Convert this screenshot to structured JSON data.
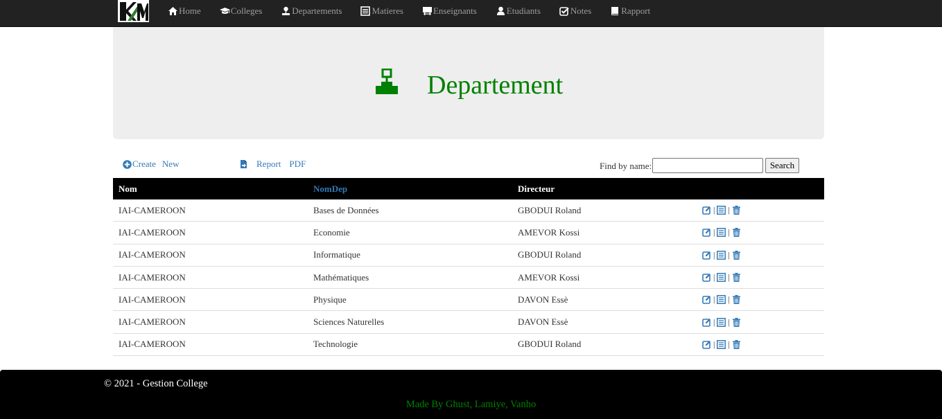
{
  "nav": {
    "items": [
      {
        "label": "Home",
        "icon": "home-icon"
      },
      {
        "label": "Colleges",
        "icon": "graduation-cap-icon"
      },
      {
        "label": "Departements",
        "icon": "map-marker-icon"
      },
      {
        "label": "Matieres",
        "icon": "list-alt-icon"
      },
      {
        "label": "Enseignants",
        "icon": "blackboard-icon"
      },
      {
        "label": "Etudiants",
        "icon": "user-icon"
      },
      {
        "label": "Notes",
        "icon": "check-icon"
      },
      {
        "label": "Rapport",
        "icon": "book-icon"
      }
    ]
  },
  "header": {
    "title": "Departement",
    "icon": "sitemap-icon"
  },
  "actions": {
    "create_label": "Create",
    "new_label": "New",
    "report_label": "Report",
    "pdf_label": "PDF",
    "search_label": "Find by name:",
    "search_value": "",
    "search_button": "Search"
  },
  "table": {
    "columns": [
      "Nom",
      "NomDep",
      "Directeur"
    ],
    "rows": [
      {
        "nom": "IAI-CAMEROON",
        "nomdep": "Bases de Données",
        "directeur": "GBODUI Roland"
      },
      {
        "nom": "IAI-CAMEROON",
        "nomdep": "Economie",
        "directeur": "AMEVOR Kossi"
      },
      {
        "nom": "IAI-CAMEROON",
        "nomdep": "Informatique",
        "directeur": "GBODUI Roland"
      },
      {
        "nom": "IAI-CAMEROON",
        "nomdep": "Mathématiques",
        "directeur": "AMEVOR Kossi"
      },
      {
        "nom": "IAI-CAMEROON",
        "nomdep": "Physique",
        "directeur": "DAVON Essè"
      },
      {
        "nom": "IAI-CAMEROON",
        "nomdep": "Sciences Naturelles",
        "directeur": "DAVON Essè"
      },
      {
        "nom": "IAI-CAMEROON",
        "nomdep": "Technologie",
        "directeur": "GBODUI Roland"
      }
    ],
    "row_actions": [
      "edit-icon",
      "details-icon",
      "trash-icon"
    ],
    "separator": "|"
  },
  "footer": {
    "copyright": "© 2021 - Gestion College",
    "made_by": "Made By Ghust, Lamiye, Vanho"
  },
  "colors": {
    "accent": "#008000",
    "link": "#337ab7",
    "navbar": "#222222"
  }
}
